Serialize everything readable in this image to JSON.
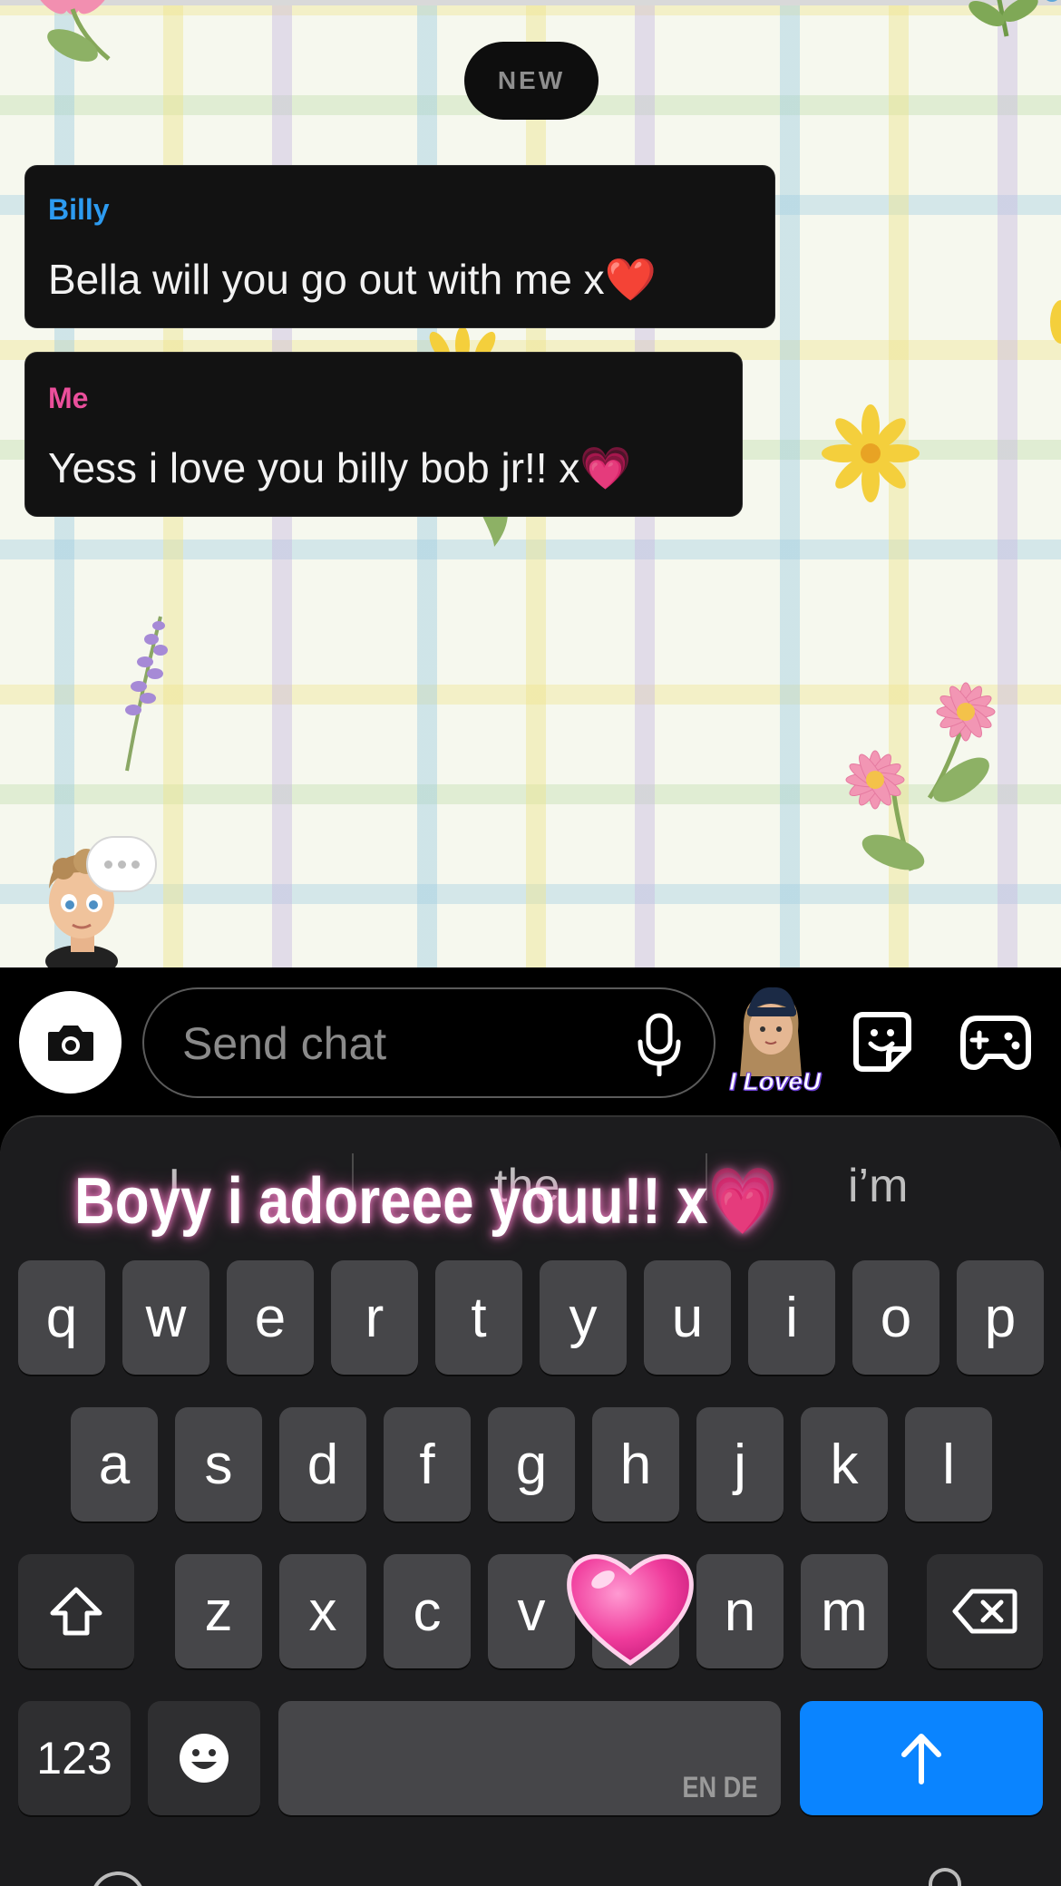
{
  "chat": {
    "new_badge": "NEW",
    "messages": [
      {
        "sender": "Billy",
        "text": "Bella will you go out with me x",
        "emoji": "❤️"
      },
      {
        "sender": "Me",
        "text": "Yess i love you billy bob jr!! x",
        "emoji": "💗"
      }
    ]
  },
  "input_bar": {
    "placeholder": "Send chat",
    "bitmoji_caption": "I LoveU"
  },
  "keyboard": {
    "suggestions": [
      "I",
      "the",
      "i’m"
    ],
    "overlay_text": "Boyy i adoreee youu!! x💗",
    "row1": [
      "q",
      "w",
      "e",
      "r",
      "t",
      "y",
      "u",
      "i",
      "o",
      "p"
    ],
    "row2": [
      "a",
      "s",
      "d",
      "f",
      "g",
      "h",
      "j",
      "k",
      "l"
    ],
    "row3": [
      "z",
      "x",
      "c",
      "v",
      "b",
      "n",
      "m"
    ],
    "num_key": "123",
    "space_lang": "EN DE"
  },
  "colors": {
    "billy": "#2d9bf0",
    "me": "#ea4f9b",
    "send": "#0a84ff"
  }
}
